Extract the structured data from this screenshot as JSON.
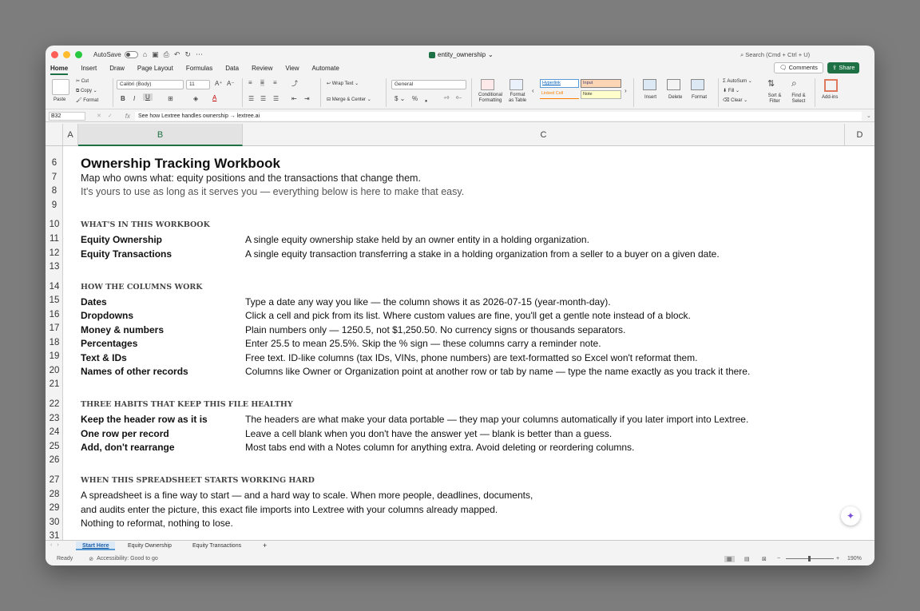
{
  "window": {
    "autosave_label": "AutoSave",
    "doc_title": "entity_ownership",
    "search_placeholder": "Search (Cmd + Ctrl + U)"
  },
  "ribbon_tabs": [
    "Home",
    "Insert",
    "Draw",
    "Page Layout",
    "Formulas",
    "Data",
    "Review",
    "View",
    "Automate"
  ],
  "active_tab": "Home",
  "buttons": {
    "comments": "Comments",
    "share": "Share"
  },
  "ribbon": {
    "paste": "Paste",
    "cut": "Cut",
    "copy": "Copy",
    "format_painter": "Format",
    "font_name": "Calibri (Body)",
    "font_size": "11",
    "wrap_text": "Wrap Text",
    "merge_center": "Merge & Center",
    "number_format": "General",
    "conditional_formatting": "Conditional Formatting",
    "format_as_table": "Format as Table",
    "style_hyperlink": "Hyperlink",
    "style_input": "Input",
    "style_linked_cell": "Linked Cell",
    "style_note": "Note",
    "insert": "Insert",
    "delete": "Delete",
    "format": "Format",
    "autosum": "AutoSum",
    "fill": "Fill",
    "clear": "Clear",
    "sort_filter": "Sort & Filter",
    "find_select": "Find & Select",
    "add_ins": "Add-ins"
  },
  "formula_bar": {
    "name_box": "B32",
    "formula": "See how Lextree handles ownership → lextree.ai"
  },
  "columns": [
    "A",
    "B",
    "C",
    "D"
  ],
  "rows": [
    "6",
    "7",
    "8",
    "9",
    "10",
    "11",
    "12",
    "13",
    "14",
    "15",
    "16",
    "17",
    "18",
    "19",
    "20",
    "21",
    "22",
    "23",
    "24",
    "25",
    "26",
    "27",
    "28",
    "29",
    "30",
    "31"
  ],
  "content": {
    "title": "Ownership Tracking Workbook",
    "subtitle1": "Map who owns what: equity positions and the transactions that change them.",
    "subtitle2": "It's yours to use as long as it serves you — everything below is here to make that easy.",
    "section1": "WHAT'S IN THIS WORKBOOK",
    "s1_items": [
      {
        "label": "Equity Ownership",
        "desc": "A single equity ownership stake held by an owner entity in a holding organization."
      },
      {
        "label": "Equity Transactions",
        "desc": "A single equity transaction transferring a stake in a holding organization from a seller to a buyer on a given date."
      }
    ],
    "section2": "HOW THE COLUMNS WORK",
    "s2_items": [
      {
        "label": "Dates",
        "desc": "Type a date any way you like — the column shows it as 2026-07-15 (year-month-day)."
      },
      {
        "label": "Dropdowns",
        "desc": "Click a cell and pick from its list. Where custom values are fine, you'll get a gentle note instead of a block."
      },
      {
        "label": "Money & numbers",
        "desc": "Plain numbers only — 1250.5, not $1,250.50. No currency signs or thousands separators."
      },
      {
        "label": "Percentages",
        "desc": "Enter 25.5 to mean 25.5%. Skip the % sign — these columns carry a reminder note."
      },
      {
        "label": "Text & IDs",
        "desc": "Free text. ID-like columns (tax IDs, VINs, phone numbers) are text-formatted so Excel won't reformat them."
      },
      {
        "label": "Names of other records",
        "desc": "Columns like Owner or Organization point at another row or tab by name — type the name exactly as you track it there."
      }
    ],
    "section3": "THREE HABITS THAT KEEP THIS FILE HEALTHY",
    "s3_items": [
      {
        "label": "Keep the header row as it is",
        "desc": "The headers are what make your data portable — they map your columns automatically if you later import into Lextree."
      },
      {
        "label": "One row per record",
        "desc": "Leave a cell blank when you don't have the answer yet — blank is better than a guess."
      },
      {
        "label": "Add, don't rearrange",
        "desc": "Most tabs end with a Notes column for anything extra. Avoid deleting or reordering columns."
      }
    ],
    "section4": "WHEN THIS SPREADSHEET STARTS WORKING HARD",
    "s4_lines": [
      "A spreadsheet is a fine way to start — and a hard way to scale. When more people, deadlines, documents,",
      "and audits enter the picture, this exact file imports into Lextree with your columns already mapped.",
      "Nothing to reformat, nothing to lose."
    ]
  },
  "sheets": [
    "Start Here",
    "Equity Ownership",
    "Equity Transactions"
  ],
  "active_sheet": "Start Here",
  "status": {
    "ready": "Ready",
    "accessibility": "Accessibility: Good to go",
    "zoom": "190%"
  }
}
